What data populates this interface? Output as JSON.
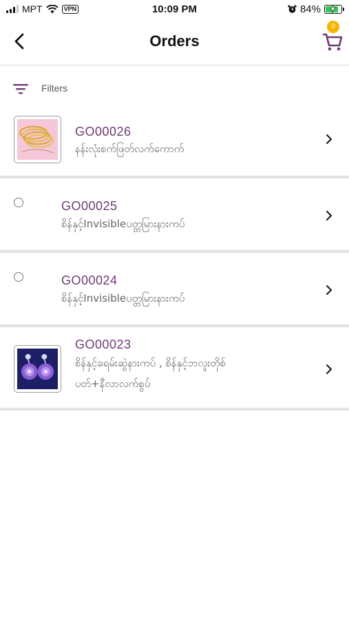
{
  "status_bar": {
    "carrier": "MPT",
    "vpn": "VPN",
    "time": "10:09 PM",
    "battery": "84%"
  },
  "header": {
    "title": "Orders",
    "cart_count": "0",
    "back_icon": "chevron-left-icon",
    "cart_icon": "cart-icon"
  },
  "filters": {
    "label": "Filters",
    "icon": "filter-icon"
  },
  "orders": [
    {
      "code": "GO00026",
      "name": "နန်းလုံးစက်ဖြတ်လက်ကောက်"
    },
    {
      "code": "GO00025",
      "name": "စိန်နှင့်Invisibleပတ္တမြားနားကပ်"
    },
    {
      "code": "GO00024",
      "name": "စိန်နှင့်Invisibleပတ္တမြားနားကပ်"
    },
    {
      "code": "GO00023",
      "name_line1": "စိန်နှင့်ခရမ်းဆွဲနားကပ် , စိန်နှင့်ဘလူးတိုစ်",
      "name_line2": "ပတ်+နီလာလက်စွပ်"
    }
  ],
  "colors": {
    "accent": "#6e3a74",
    "badge": "#f5b400",
    "divider": "#e2e2e2"
  }
}
